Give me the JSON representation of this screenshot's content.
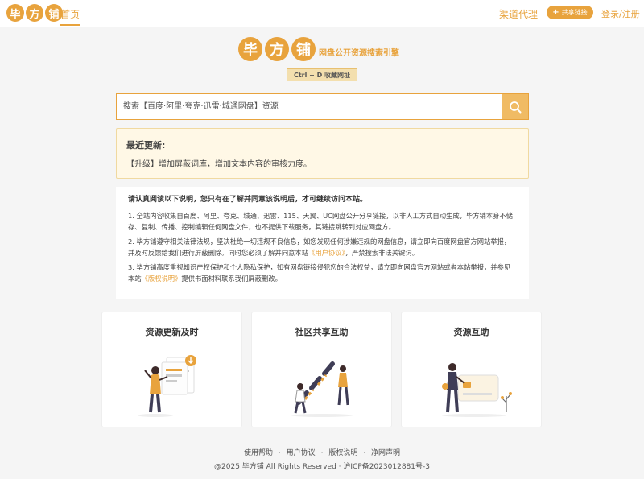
{
  "header": {
    "logo_chars": [
      "毕",
      "方",
      "铺"
    ],
    "home_label": "首页",
    "agent_label": "渠道代理",
    "share_label": "共享链接",
    "login_label": "登录/注册"
  },
  "brand": {
    "chars": [
      "毕",
      "方",
      "铺"
    ],
    "slogan": "网盘公开资源搜索引擎",
    "bookmark_hint": "Ctrl + D 收藏网址"
  },
  "search": {
    "placeholder": "搜索【百度·阿里·夸克·迅雷·城通网盘】资源"
  },
  "update": {
    "title": "最近更新:",
    "text": "【升级】增加屏蔽词库，增加文本内容的审核力度。"
  },
  "disclaimer": {
    "heading": "请认真阅读以下说明，您只有在了解并同意该说明后，才可继续访问本站。",
    "p1": "1. 全站内容收集自百度、阿里、夸克、城通、迅雷、115、天翼、UC网盘公开分享链接，以非人工方式自动生成，毕方铺本身不储存、复制、传播、控制编辑任何网盘文件，也不提供下载服务，其链接跳转到对应网盘方。",
    "p2_a": "2. 毕方铺遵守相关法律法规，坚决杜绝一切违规不良信息，如您发现任何涉嫌违规的网盘信息，请立即向百度网盘官方网站举报，并及时反馈给我们进行屏蔽删除。同时您必须了解并同意本站",
    "p2_link": "《用户协议》",
    "p2_b": "，严禁搜索非法关键词。",
    "p3_a": "3. 毕方铺高度重视知识产权保护和个人隐私保护，如有网盘链接侵犯您的合法权益，请立即向网盘官方网站或者本站举报，并参见本站",
    "p3_link": "《版权说明》",
    "p3_b": "提供书面材料联系我们屏蔽删改。"
  },
  "cards": [
    {
      "title": "资源更新及时"
    },
    {
      "title": "社区共享互助"
    },
    {
      "title": "资源互助"
    }
  ],
  "footer": {
    "links": [
      "使用帮助",
      "用户协议",
      "版权说明",
      "净网声明"
    ],
    "separator": "·",
    "copyright": "@2025 毕方铺 All Rights Reserved · 沪ICP备2023012881号-3"
  },
  "colors": {
    "accent": "#e8a33d",
    "notice_bg": "#fff8e6"
  }
}
